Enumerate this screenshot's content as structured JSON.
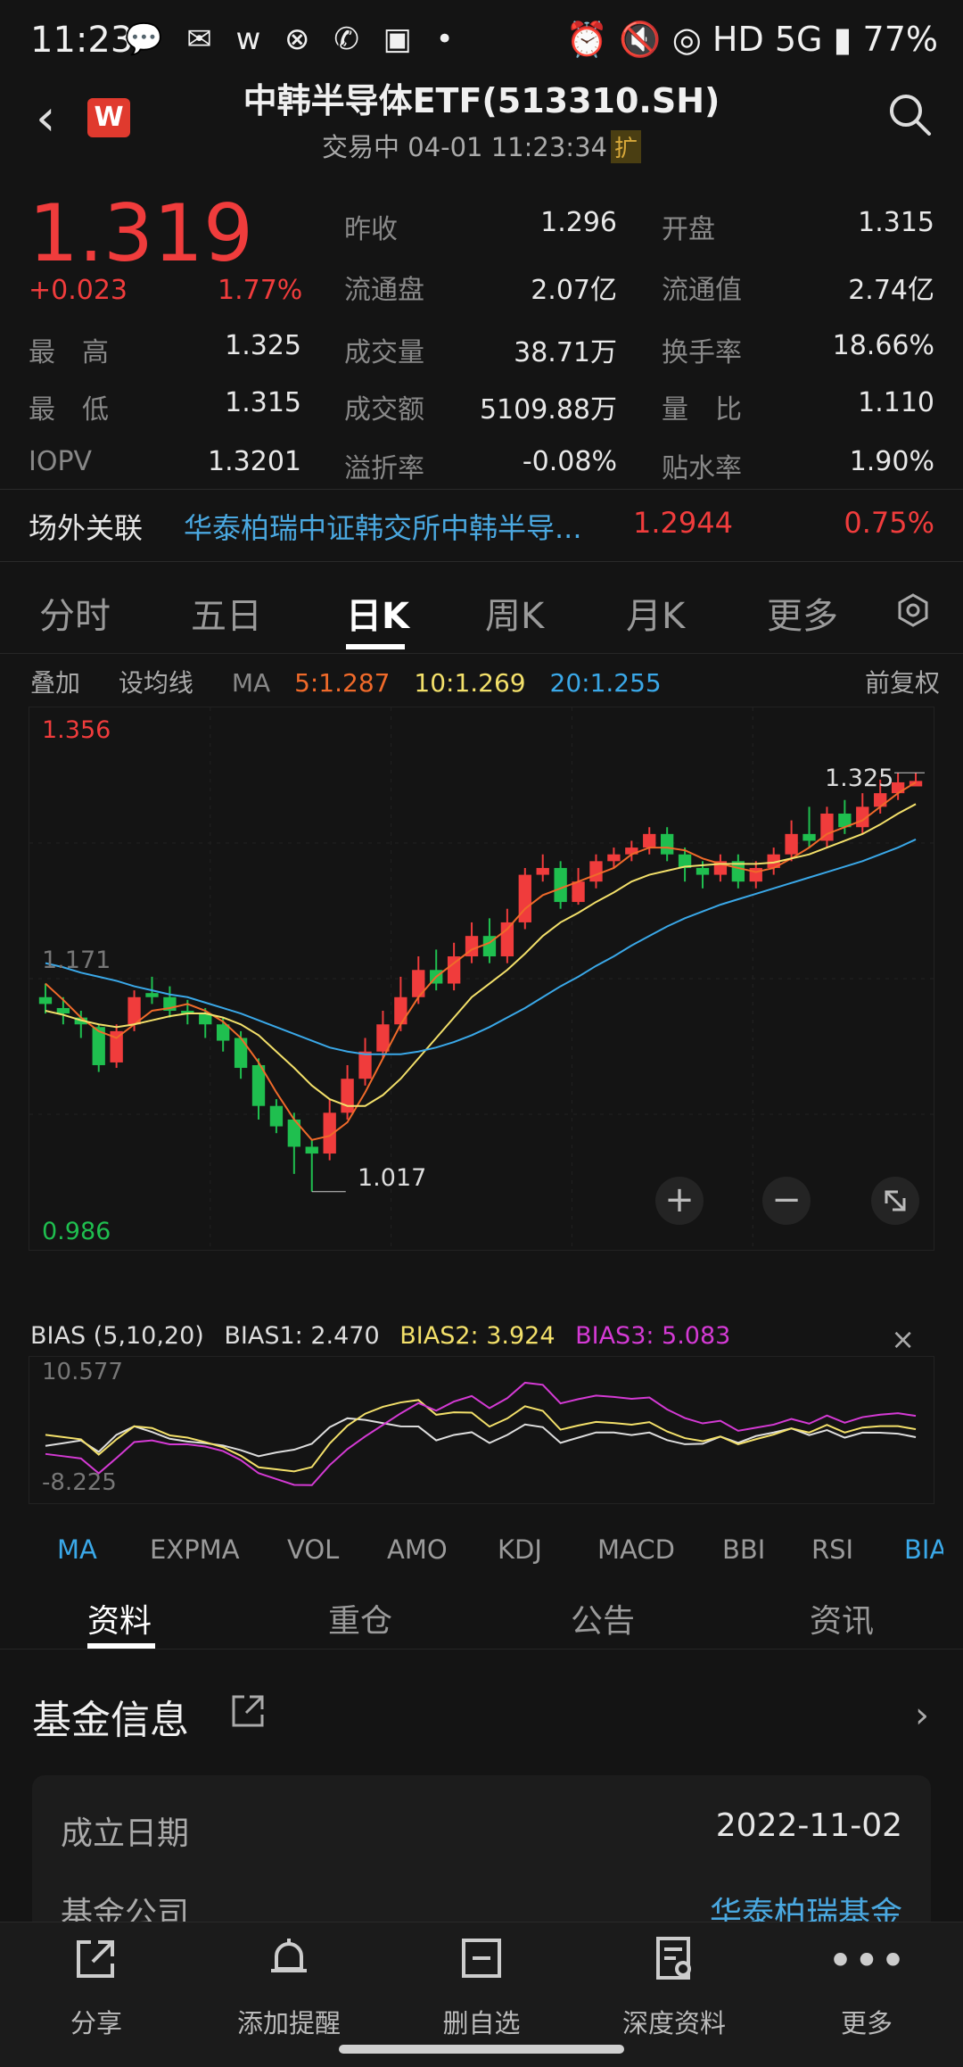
{
  "status": {
    "time": "11:23",
    "left_icons": "💬 ✉ w ⊗ ✆ ▣ •",
    "right": "⏰ 🔇 ◎ HD 5G ▮ 77%"
  },
  "header": {
    "title": "中韩半导体ETF(513310.SH)",
    "subtitle": "交易中 04-01 11:23:34",
    "extended": "扩",
    "logo": "W"
  },
  "quote": {
    "price": "1.319",
    "change": "+0.023",
    "pct": "1.77%",
    "rows": [
      [
        {
          "l": "",
          "v": ""
        },
        {
          "l": "昨收",
          "v": "1.296"
        },
        {
          "l": "开盘",
          "v": "1.315"
        }
      ],
      [
        {
          "l": "",
          "v": ""
        },
        {
          "l": "流通盘",
          "v": "2.07亿"
        },
        {
          "l": "流通值",
          "v": "2.74亿"
        }
      ],
      [
        {
          "l": "最　高",
          "v": "1.325"
        },
        {
          "l": "成交量",
          "v": "38.71万"
        },
        {
          "l": "换手率",
          "v": "18.66%"
        }
      ],
      [
        {
          "l": "最　低",
          "v": "1.315"
        },
        {
          "l": "成交额",
          "v": "5109.88万"
        },
        {
          "l": "量　比",
          "v": "1.110"
        }
      ],
      [
        {
          "l": "IOPV",
          "v": "1.3201"
        },
        {
          "l": "溢折率",
          "v": "-0.08%"
        },
        {
          "l": "贴水率",
          "v": "1.90%"
        }
      ]
    ]
  },
  "otc": {
    "label": "场外关联",
    "name": "华泰柏瑞中证韩交所中韩半导...",
    "price": "1.2944",
    "pct": "0.75%"
  },
  "tabs": [
    "分时",
    "五日",
    "日K",
    "周K",
    "月K",
    "更多"
  ],
  "ma": {
    "overlay": "叠加",
    "set": "设均线",
    "ma": "MA",
    "ma5": "5:1.287",
    "ma10": "10:1.269",
    "ma20": "20:1.255",
    "adj": "前复权"
  },
  "chart_labels": {
    "high": "1.356",
    "low": "0.986",
    "mid": "1.171",
    "max_mark": "1.325",
    "min_mark": "1.017"
  },
  "bias": {
    "title": "BIAS (5,10,20)",
    "b1": "BIAS1: 2.470",
    "b2": "BIAS2: 3.924",
    "b3": "BIAS3: 5.083",
    "top": "10.577",
    "bottom": "-8.225",
    "close": "×"
  },
  "indicators": [
    "MA",
    "EXPMA",
    "VOL",
    "AMO",
    "KDJ",
    "MACD",
    "BBI",
    "RSI",
    "BIA"
  ],
  "sections": [
    "资料",
    "重仓",
    "公告",
    "资讯"
  ],
  "fund": {
    "title": "基金信息",
    "found_label": "成立日期",
    "found_value": "2022-11-02",
    "company_label": "基金公司",
    "company_value": "华泰柏瑞基金"
  },
  "bottom_nav": [
    {
      "icon": "share-icon",
      "label": "分享"
    },
    {
      "icon": "bell-icon",
      "label": "添加提醒"
    },
    {
      "icon": "minus-box-icon",
      "label": "删自选"
    },
    {
      "icon": "report-icon",
      "label": "深度资料"
    },
    {
      "icon": "more-icon",
      "label": "更多"
    }
  ],
  "colors": {
    "up": "#f03c3c",
    "down": "#1fbf4f",
    "ma5": "#f06a2a",
    "ma10": "#f3e06a",
    "ma20": "#3aa8e8",
    "bias3": "#d43ad4",
    "link": "#4aa8e0"
  },
  "chart_data": {
    "type": "candlestick",
    "ylim": [
      0.986,
      1.356
    ],
    "candles": [
      [
        1.16,
        1.155,
        1.17,
        1.148
      ],
      [
        1.152,
        1.148,
        1.16,
        1.14
      ],
      [
        1.145,
        1.14,
        1.15,
        1.13
      ],
      [
        1.138,
        1.11,
        1.14,
        1.105
      ],
      [
        1.112,
        1.135,
        1.14,
        1.108
      ],
      [
        1.14,
        1.16,
        1.165,
        1.135
      ],
      [
        1.163,
        1.16,
        1.175,
        1.155
      ],
      [
        1.16,
        1.15,
        1.168,
        1.145
      ],
      [
        1.15,
        1.148,
        1.158,
        1.14
      ],
      [
        1.148,
        1.14,
        1.152,
        1.13
      ],
      [
        1.14,
        1.128,
        1.145,
        1.12
      ],
      [
        1.13,
        1.108,
        1.135,
        1.1
      ],
      [
        1.11,
        1.08,
        1.115,
        1.07
      ],
      [
        1.08,
        1.065,
        1.085,
        1.06
      ],
      [
        1.07,
        1.05,
        1.075,
        1.03
      ],
      [
        1.05,
        1.045,
        1.055,
        1.017
      ],
      [
        1.045,
        1.075,
        1.085,
        1.04
      ],
      [
        1.075,
        1.1,
        1.11,
        1.07
      ],
      [
        1.1,
        1.12,
        1.13,
        1.095
      ],
      [
        1.12,
        1.14,
        1.15,
        1.115
      ],
      [
        1.14,
        1.16,
        1.175,
        1.135
      ],
      [
        1.16,
        1.18,
        1.19,
        1.155
      ],
      [
        1.18,
        1.17,
        1.195,
        1.165
      ],
      [
        1.17,
        1.19,
        1.2,
        1.165
      ],
      [
        1.19,
        1.205,
        1.215,
        1.185
      ],
      [
        1.205,
        1.19,
        1.218,
        1.185
      ],
      [
        1.19,
        1.215,
        1.225,
        1.185
      ],
      [
        1.215,
        1.25,
        1.255,
        1.21
      ],
      [
        1.25,
        1.255,
        1.265,
        1.245
      ],
      [
        1.255,
        1.23,
        1.26,
        1.225
      ],
      [
        1.23,
        1.245,
        1.255,
        1.228
      ],
      [
        1.245,
        1.26,
        1.265,
        1.24
      ],
      [
        1.26,
        1.265,
        1.27,
        1.255
      ],
      [
        1.265,
        1.27,
        1.275,
        1.26
      ],
      [
        1.27,
        1.28,
        1.285,
        1.265
      ],
      [
        1.28,
        1.265,
        1.285,
        1.26
      ],
      [
        1.265,
        1.255,
        1.27,
        1.245
      ],
      [
        1.255,
        1.25,
        1.26,
        1.24
      ],
      [
        1.25,
        1.26,
        1.265,
        1.245
      ],
      [
        1.26,
        1.245,
        1.265,
        1.24
      ],
      [
        1.245,
        1.255,
        1.26,
        1.24
      ],
      [
        1.255,
        1.265,
        1.27,
        1.25
      ],
      [
        1.265,
        1.28,
        1.29,
        1.26
      ],
      [
        1.28,
        1.275,
        1.3,
        1.27
      ],
      [
        1.275,
        1.295,
        1.3,
        1.27
      ],
      [
        1.295,
        1.285,
        1.305,
        1.28
      ],
      [
        1.285,
        1.3,
        1.31,
        1.28
      ],
      [
        1.3,
        1.31,
        1.32,
        1.295
      ],
      [
        1.31,
        1.318,
        1.325,
        1.305
      ],
      [
        1.315,
        1.319,
        1.325,
        1.315
      ]
    ],
    "ma5": [
      1.17,
      1.158,
      1.145,
      1.135,
      1.13,
      1.14,
      1.15,
      1.152,
      1.155,
      1.15,
      1.142,
      1.13,
      1.112,
      1.09,
      1.07,
      1.055,
      1.058,
      1.068,
      1.09,
      1.115,
      1.14,
      1.16,
      1.175,
      1.185,
      1.195,
      1.2,
      1.21,
      1.225,
      1.235,
      1.24,
      1.245,
      1.25,
      1.255,
      1.265,
      1.27,
      1.27,
      1.268,
      1.262,
      1.258,
      1.255,
      1.252,
      1.255,
      1.262,
      1.27,
      1.28,
      1.285,
      1.29,
      1.3,
      1.31,
      1.318
    ],
    "ma10": [
      1.15,
      1.147,
      1.143,
      1.14,
      1.138,
      1.14,
      1.143,
      1.146,
      1.148,
      1.148,
      1.145,
      1.14,
      1.132,
      1.12,
      1.108,
      1.095,
      1.085,
      1.08,
      1.08,
      1.088,
      1.1,
      1.115,
      1.13,
      1.145,
      1.16,
      1.17,
      1.18,
      1.192,
      1.205,
      1.215,
      1.222,
      1.23,
      1.237,
      1.245,
      1.25,
      1.253,
      1.256,
      1.257,
      1.258,
      1.258,
      1.258,
      1.259,
      1.262,
      1.265,
      1.27,
      1.275,
      1.28,
      1.287,
      1.295,
      1.302
    ],
    "ma20": [
      1.185,
      1.182,
      1.178,
      1.175,
      1.172,
      1.168,
      1.165,
      1.162,
      1.16,
      1.156,
      1.152,
      1.148,
      1.143,
      1.138,
      1.133,
      1.128,
      1.123,
      1.12,
      1.118,
      1.118,
      1.118,
      1.12,
      1.123,
      1.127,
      1.132,
      1.138,
      1.145,
      1.152,
      1.16,
      1.168,
      1.175,
      1.183,
      1.19,
      1.198,
      1.205,
      1.212,
      1.218,
      1.223,
      1.228,
      1.232,
      1.236,
      1.24,
      1.244,
      1.248,
      1.252,
      1.256,
      1.26,
      1.265,
      1.27,
      1.276
    ]
  }
}
